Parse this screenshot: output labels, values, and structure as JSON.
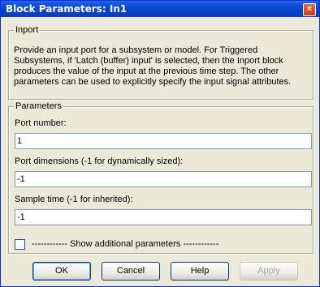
{
  "window": {
    "title": "Block Parameters: In1",
    "close_icon": "×"
  },
  "inport": {
    "legend": "Inport",
    "description": "Provide an input port for a subsystem or model. For Triggered Subsystems, if 'Latch (buffer) input' is selected, then the Inport block produces the value of the input at the previous time step. The other parameters can be used to explicitly specify the input signal attributes."
  },
  "parameters": {
    "legend": "Parameters",
    "port_number_label": "Port number:",
    "port_number_value": "1",
    "port_dimensions_label": "Port dimensions (-1 for dynamically sized):",
    "port_dimensions_value": "-1",
    "sample_time_label": "Sample time (-1 for inherited):",
    "sample_time_value": "-1",
    "show_additional_label": "------------ Show additional parameters ------------",
    "show_additional_checked": false
  },
  "buttons": {
    "ok": "OK",
    "cancel": "Cancel",
    "help": "Help",
    "apply": "Apply"
  },
  "colors": {
    "titlebar": "#0a4fd8",
    "dialog_bg": "#ece9d8"
  }
}
